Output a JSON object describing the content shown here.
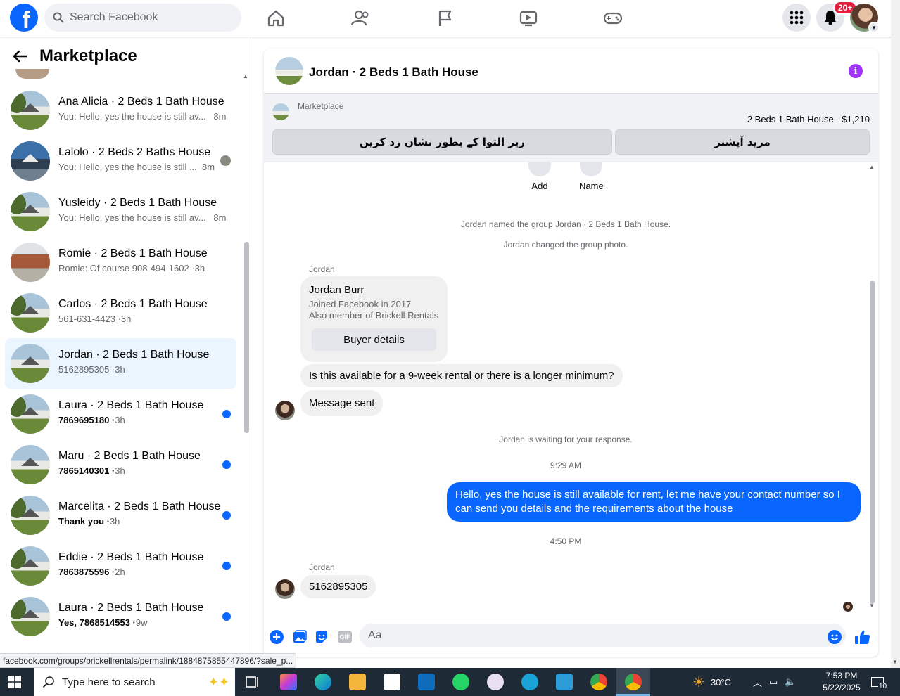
{
  "topbar": {
    "logo": "f",
    "search_placeholder": "Search Facebook",
    "notif_badge": "20+"
  },
  "sidebar": {
    "title": "Marketplace",
    "conversations": [
      {
        "title": "Ana Alicia · 2 Beds 1 Bath House",
        "preview": "You: Hello, yes the house is still av...",
        "time": "8m",
        "unread": false
      },
      {
        "title": "Lalolo · 2 Beds 2 Baths House",
        "preview": "You: Hello, yes the house is still ...",
        "time": "8m",
        "unread": false
      },
      {
        "title": "Yusleidy · 2 Beds 1 Bath House",
        "preview": "You: Hello, yes the house is still av...",
        "time": "8m",
        "unread": false
      },
      {
        "title": "Romie · 2 Beds 1 Bath House",
        "preview": "Romie: Of course 908-494-1602 ·",
        "time": "3h",
        "unread": false
      },
      {
        "title": "Carlos · 2 Beds 1 Bath House",
        "preview": "561-631-4423 ·",
        "time": "3h",
        "unread": false
      },
      {
        "title": "Jordan · 2 Beds 1 Bath House",
        "preview": "5162895305 ·",
        "time": "3h",
        "unread": false
      },
      {
        "title": "Laura · 2 Beds 1 Bath House",
        "preview": "7869695180 ·",
        "time": "3h",
        "unread": true
      },
      {
        "title": "Maru · 2 Beds 1 Bath House",
        "preview": "7865140301 ·",
        "time": "3h",
        "unread": true
      },
      {
        "title": "Marcelita · 2 Beds 1 Bath House",
        "preview": "Thank you ·",
        "time": "3h",
        "unread": true
      },
      {
        "title": "Eddie · 2 Beds 1 Bath House",
        "preview": "7863875596 ·",
        "time": "2h",
        "unread": true
      },
      {
        "title": "Laura · 2 Beds 1 Bath House",
        "preview": "Yes, 7868514553 ·",
        "time": "9w",
        "unread": true
      }
    ]
  },
  "chat": {
    "title": "Jordan · 2 Beds 1 Bath House",
    "banner": {
      "label": "Marketplace",
      "price": "2 Beds 1 Bath House - $1,210",
      "btn_pending": "زیر التوا کے بطور نشان زد کریں",
      "btn_more": "مزید آپشنز"
    },
    "actions": {
      "add": "Add",
      "name": "Name"
    },
    "system": {
      "named": "Jordan named the group Jordan · 2 Beds 1 Bath House.",
      "photo": "Jordan changed the group photo.",
      "waiting": "Jordan is waiting for your response."
    },
    "sender1": "Jordan",
    "card": {
      "name": "Jordan Burr",
      "joined": "Joined Facebook in 2017",
      "member": "Also member of Brickell Rentals",
      "button": "Buyer details"
    },
    "msg_question": "Is this available for a 9-week rental or there is a longer minimum?",
    "msg_sent": "Message sent",
    "time1": "9:29 AM",
    "msg_out": "Hello, yes the house is still available for rent, let me have your contact number so I can send you details and the requirements about the house",
    "time2": "4:50 PM",
    "sender2": "Jordan",
    "msg_phone": "5162895305",
    "composer_placeholder": "Aa",
    "gif": "GIF"
  },
  "status_url": "facebook.com/groups/brickellrentals/permalink/1884875855447896/?sale_p...",
  "taskbar": {
    "search": "Type here to search",
    "temp": "30°C",
    "time": "7:53 PM",
    "date": "5/22/2025",
    "notif": "10"
  },
  "colors": {
    "brand": "#0866ff",
    "unread_dot": "#0866ff",
    "info": "#a033ff",
    "badge": "#e41e3f"
  }
}
